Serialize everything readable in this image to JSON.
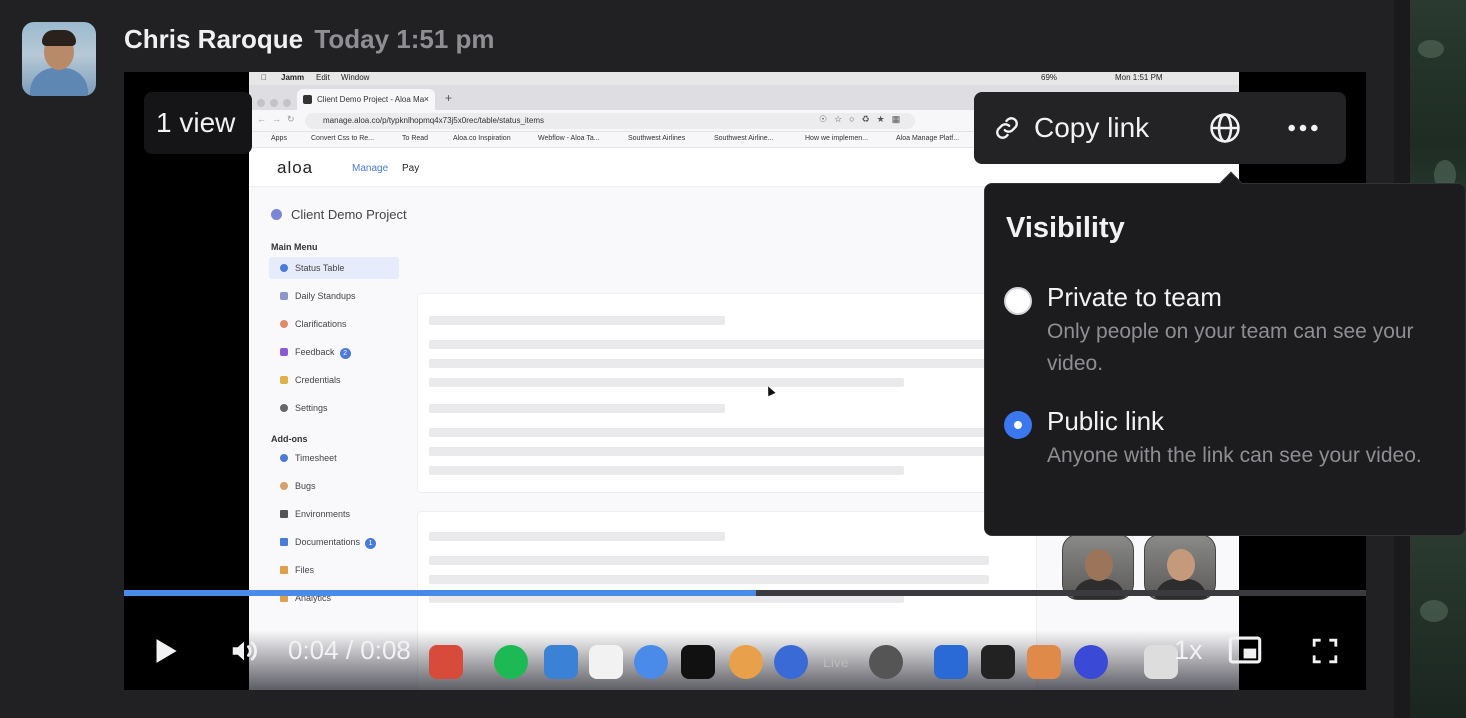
{
  "author": {
    "name": "Chris Raroque",
    "timestamp": "Today 1:51 pm"
  },
  "player": {
    "views_label": "1 view",
    "copy_link_label": "Copy link",
    "time_current": "0:04",
    "time_separator": " / ",
    "time_total": "0:08",
    "speed_label": "1x",
    "progress_fraction": 0.509
  },
  "visibility": {
    "title": "Visibility",
    "options": [
      {
        "label": "Private to team",
        "description": "Only people on your team can see your video.",
        "selected": false
      },
      {
        "label": "Public link",
        "description": "Anyone with the link can see your video.",
        "selected": true
      }
    ]
  },
  "recording": {
    "menubar": {
      "app": "Jamm",
      "edit": "Edit",
      "window": "Window",
      "battery": "69%",
      "clock": "Mon 1:51 PM"
    },
    "browser": {
      "tab_title": "Client Demo Project - Aloa Ma",
      "tab_close": "×",
      "new_tab": "+",
      "url": "manage.aloa.co/p/typknlhopmq4x73j5x0rec/table/status_items",
      "bookmarks": [
        "Apps",
        "Convert Css to Re...",
        "To Read",
        "Aloa.co Inspiration",
        "Webflow - Aloa Ta...",
        "Southwest Airlines",
        "Southwest Airline...",
        "How we implemen...",
        "Aloa Manage Platf..."
      ]
    },
    "app": {
      "logo": "aloa",
      "nav_manage": "Manage",
      "nav_pay": "Pay",
      "project_title": "Client Demo Project",
      "main_menu_heading": "Main Menu",
      "main_menu": [
        {
          "label": "Status Table",
          "badge": ""
        },
        {
          "label": "Daily Standups",
          "badge": ""
        },
        {
          "label": "Clarifications",
          "badge": ""
        },
        {
          "label": "Feedback",
          "badge": "2"
        },
        {
          "label": "Credentials",
          "badge": ""
        },
        {
          "label": "Settings",
          "badge": ""
        }
      ],
      "addons_heading": "Add-ons",
      "addons": [
        {
          "label": "Timesheet",
          "badge": ""
        },
        {
          "label": "Bugs",
          "badge": ""
        },
        {
          "label": "Environments",
          "badge": ""
        },
        {
          "label": "Documentations",
          "badge": "1"
        },
        {
          "label": "Files",
          "badge": ""
        },
        {
          "label": "Analytics",
          "badge": ""
        }
      ],
      "dock_live_label": "Live"
    }
  },
  "colors": {
    "background": "#212123",
    "accent": "#4a8ae8",
    "radio_selected": "#3b78f0",
    "popover_bg": "#1c1c1e",
    "muted_text": "#8e8e93"
  },
  "icons": [
    "link-icon",
    "globe-icon",
    "more-icon",
    "play-icon",
    "volume-icon",
    "picture-in-picture-icon",
    "fullscreen-icon"
  ]
}
